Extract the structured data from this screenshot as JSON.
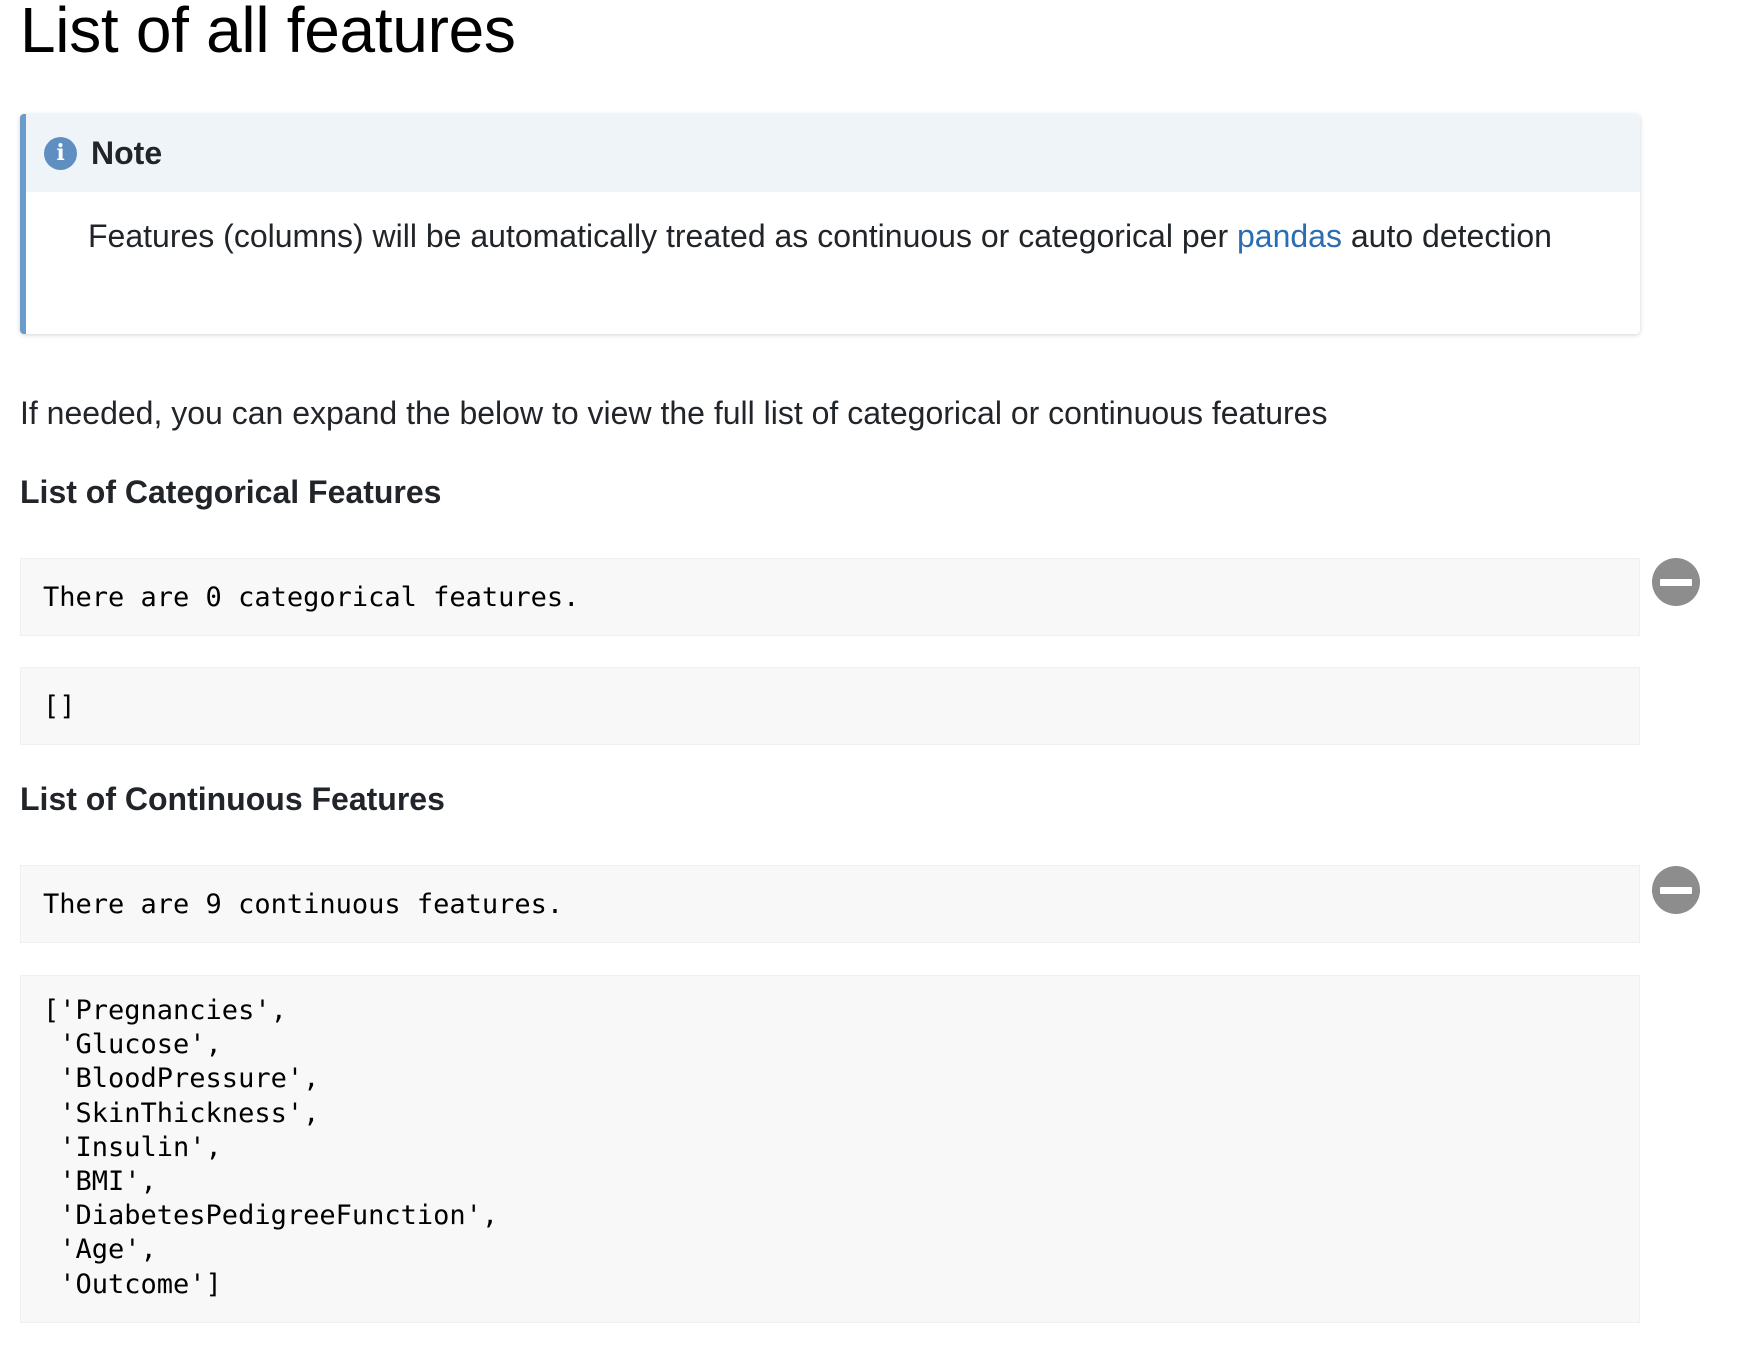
{
  "page": {
    "title": "List of all features"
  },
  "note": {
    "title": "Note",
    "icon": "info-icon",
    "body_before_link": "Features (columns) will be automatically treated as continuous or categorical per ",
    "link_text": "pandas",
    "body_after_link": " auto detection"
  },
  "intro": "If needed, you can expand the below to view the full list of categorical or continuous features",
  "categorical": {
    "heading": "List of Categorical Features",
    "summary": "There are 0 categorical features.",
    "list": "[]",
    "toggle_icon": "minus-circle-icon"
  },
  "continuous": {
    "heading": "List of Continuous Features",
    "summary": "There are 9 continuous features.",
    "list": "['Pregnancies',\n 'Glucose',\n 'BloodPressure',\n 'SkinThickness',\n 'Insulin',\n 'BMI',\n 'DiabetesPedigreeFunction',\n 'Age',\n 'Outcome']",
    "toggle_icon": "minus-circle-icon"
  },
  "colors": {
    "note_accent": "#6b9bc9",
    "note_header_bg": "#eff4f9",
    "link": "#2a6db3",
    "code_bg": "#f8f8f8",
    "toggle_bg": "#8d8d8d"
  }
}
